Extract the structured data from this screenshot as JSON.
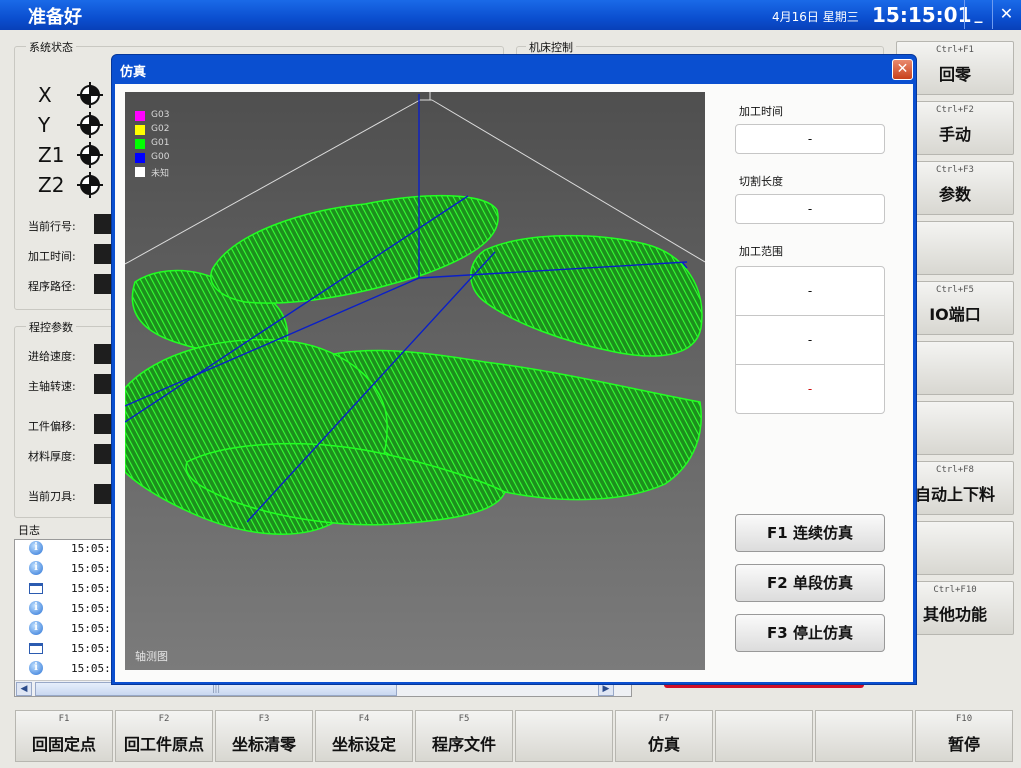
{
  "app": {
    "title": "准备好",
    "date": "4月16日 星期三",
    "time": "15:15:01",
    "minimize": "_",
    "close": "✕"
  },
  "system_status": {
    "title": "系统状态",
    "axes": [
      "X",
      "Y",
      "Z1",
      "Z2"
    ],
    "labels": [
      "当前行号:",
      "加工时间:",
      "程序路径:"
    ]
  },
  "machine_control": {
    "title": "机床控制"
  },
  "program_params": {
    "title": "程控参数",
    "labels": [
      "进给速度:",
      "主轴转速:",
      "工件偏移:",
      "材料厚度:",
      "当前刀具:"
    ]
  },
  "log": {
    "title": "日志",
    "rows": [
      {
        "icon": "info-icon",
        "time": "15:05:2"
      },
      {
        "icon": "info-icon",
        "time": "15:05:2"
      },
      {
        "icon": "window-icon",
        "time": "15:05:2"
      },
      {
        "icon": "info-icon",
        "time": "15:05:2"
      },
      {
        "icon": "info-icon",
        "time": "15:05:3"
      },
      {
        "icon": "window-icon",
        "time": "15:05:4"
      },
      {
        "icon": "info-icon",
        "time": "15:05:4"
      }
    ],
    "scroll_grip": "|||"
  },
  "right_buttons": [
    {
      "hotkey": "Ctrl+F1",
      "label": "回零"
    },
    {
      "hotkey": "Ctrl+F2",
      "label": "手动"
    },
    {
      "hotkey": "Ctrl+F3",
      "label": "参数"
    },
    {
      "hotkey": "",
      "label": ""
    },
    {
      "hotkey": "Ctrl+F5",
      "label": "IO端口"
    },
    {
      "hotkey": "",
      "label": ""
    },
    {
      "hotkey": "",
      "label": ""
    },
    {
      "hotkey": "Ctrl+F8",
      "label": "自动上下料"
    },
    {
      "hotkey": "",
      "label": ""
    },
    {
      "hotkey": "Ctrl+F10",
      "label": "其他功能"
    }
  ],
  "bottom_buttons": [
    {
      "hotkey": "F1",
      "label": "回固定点"
    },
    {
      "hotkey": "F2",
      "label": "回工件原点"
    },
    {
      "hotkey": "F3",
      "label": "坐标清零"
    },
    {
      "hotkey": "F4",
      "label": "坐标设定"
    },
    {
      "hotkey": "F5",
      "label": "程序文件"
    },
    {
      "hotkey": "",
      "label": ""
    },
    {
      "hotkey": "F7",
      "label": "仿真"
    },
    {
      "hotkey": "",
      "label": ""
    },
    {
      "hotkey": "",
      "label": ""
    },
    {
      "hotkey": "F10",
      "label": "暂停"
    }
  ],
  "simulation": {
    "title": "仿真",
    "close_glyph": "✕",
    "legend": [
      {
        "code": "G03",
        "color": "#ff00ff"
      },
      {
        "code": "G02",
        "color": "#ffff00"
      },
      {
        "code": "G01",
        "color": "#00ff00"
      },
      {
        "code": "G00",
        "color": "#0000ff"
      },
      {
        "code": "未知",
        "color": "#ffffff"
      }
    ],
    "view_label": "轴测图",
    "toolpath_color": "#22ff22",
    "machining_time": {
      "label": "加工时间",
      "value": "-"
    },
    "cut_length": {
      "label": "切割长度",
      "value": "-"
    },
    "range": {
      "label": "加工范围",
      "values": [
        "-",
        "-",
        "-"
      ]
    },
    "buttons": [
      "F1 连续仿真",
      "F2 单段仿真",
      "F3 停止仿真"
    ]
  }
}
